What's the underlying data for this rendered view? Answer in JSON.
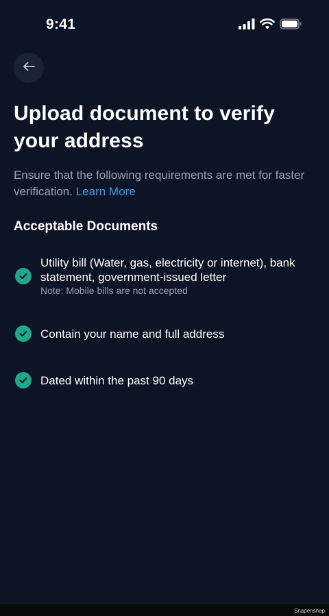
{
  "status_bar": {
    "time": "9:41"
  },
  "header": {
    "title": "Upload document to verify your address",
    "subtitle": "Ensure that the following requirements are met for faster verification.",
    "learn_more": "Learn More"
  },
  "section": {
    "heading": "Acceptable Documents",
    "items": [
      {
        "label": "Utility bill (Water, gas, electricity or internet), bank statement, government-issued letter",
        "note": "Note: Mobile bills are not accepted"
      },
      {
        "label": "Contain your name and full address"
      },
      {
        "label": "Dated within the past 90 days"
      }
    ]
  },
  "watermark": "Snapensnap",
  "icons": {
    "back": "arrow-left-icon",
    "check": "check-circle-icon",
    "signal": "cellular-signal-icon",
    "wifi": "wifi-icon",
    "battery": "battery-icon"
  },
  "colors": {
    "background": "#0d1425",
    "accent_link": "#3d9cf0",
    "check_green": "#1fa88a",
    "muted_text": "#9aa3b5"
  }
}
